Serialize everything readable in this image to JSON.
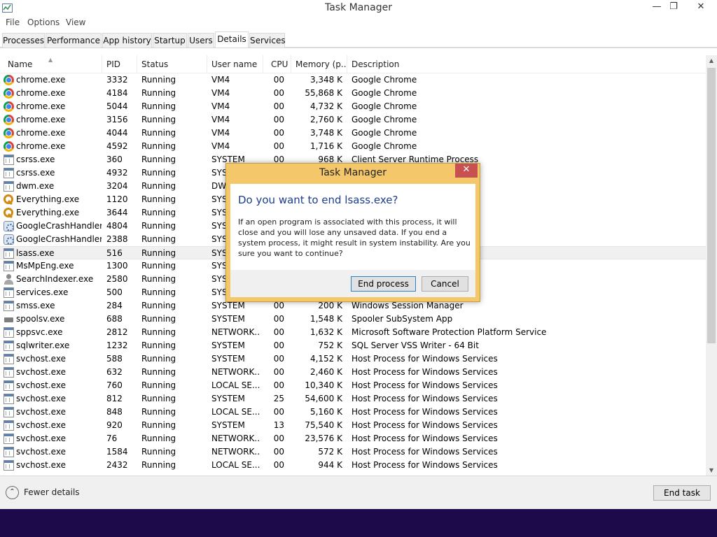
{
  "window": {
    "title": "Task Manager",
    "min_glyph": "—",
    "max_glyph": "❐",
    "close_glyph": "✕"
  },
  "menu": [
    "File",
    "Options",
    "View"
  ],
  "tabs": [
    "Processes",
    "Performance",
    "App history",
    "Startup",
    "Users",
    "Details",
    "Services"
  ],
  "active_tab": "Details",
  "columns": {
    "name": "Name",
    "pid": "PID",
    "status": "Status",
    "user": "User name",
    "cpu": "CPU",
    "memory": "Memory (p...",
    "description": "Description"
  },
  "rows": [
    {
      "icon": "chrome-icon",
      "name": "chrome.exe",
      "pid": "3332",
      "status": "Running",
      "user": "VM4",
      "cpu": "00",
      "memory": "3,348 K",
      "description": "Google Chrome"
    },
    {
      "icon": "chrome-icon",
      "name": "chrome.exe",
      "pid": "4184",
      "status": "Running",
      "user": "VM4",
      "cpu": "00",
      "memory": "55,868 K",
      "description": "Google Chrome"
    },
    {
      "icon": "chrome-icon",
      "name": "chrome.exe",
      "pid": "5044",
      "status": "Running",
      "user": "VM4",
      "cpu": "00",
      "memory": "4,732 K",
      "description": "Google Chrome"
    },
    {
      "icon": "chrome-icon",
      "name": "chrome.exe",
      "pid": "3156",
      "status": "Running",
      "user": "VM4",
      "cpu": "00",
      "memory": "2,760 K",
      "description": "Google Chrome"
    },
    {
      "icon": "chrome-icon",
      "name": "chrome.exe",
      "pid": "4044",
      "status": "Running",
      "user": "VM4",
      "cpu": "00",
      "memory": "3,748 K",
      "description": "Google Chrome"
    },
    {
      "icon": "chrome-icon",
      "name": "chrome.exe",
      "pid": "4592",
      "status": "Running",
      "user": "VM4",
      "cpu": "00",
      "memory": "1,716 K",
      "description": "Google Chrome"
    },
    {
      "icon": "exe-icon",
      "name": "csrss.exe",
      "pid": "360",
      "status": "Running",
      "user": "SYSTEM",
      "cpu": "00",
      "memory": "968 K",
      "description": "Client Server Runtime Process"
    },
    {
      "icon": "exe-icon",
      "name": "csrss.exe",
      "pid": "4932",
      "status": "Running",
      "user": "SYS",
      "cpu": "",
      "memory": "",
      "description": ""
    },
    {
      "icon": "exe-icon",
      "name": "dwm.exe",
      "pid": "3204",
      "status": "Running",
      "user": "DW",
      "cpu": "",
      "memory": "",
      "description": ""
    },
    {
      "icon": "key-icon",
      "name": "Everything.exe",
      "pid": "1120",
      "status": "Running",
      "user": "SYS",
      "cpu": "",
      "memory": "",
      "description": ""
    },
    {
      "icon": "key-icon",
      "name": "Everything.exe",
      "pid": "3644",
      "status": "Running",
      "user": "SYS",
      "cpu": "",
      "memory": "",
      "description": ""
    },
    {
      "icon": "gear-exe-icon",
      "name": "GoogleCrashHandler...",
      "pid": "4804",
      "status": "Running",
      "user": "SYS",
      "cpu": "",
      "memory": "",
      "description": ""
    },
    {
      "icon": "gear-exe-icon",
      "name": "GoogleCrashHandler...",
      "pid": "2388",
      "status": "Running",
      "user": "SYS",
      "cpu": "",
      "memory": "",
      "description": ""
    },
    {
      "icon": "exe-icon",
      "name": "lsass.exe",
      "pid": "516",
      "status": "Running",
      "user": "SYS",
      "cpu": "",
      "memory": "",
      "description": "",
      "selected": true
    },
    {
      "icon": "exe-icon",
      "name": "MsMpEng.exe",
      "pid": "1300",
      "status": "Running",
      "user": "SYS",
      "cpu": "",
      "memory": "",
      "description": ""
    },
    {
      "icon": "user-search-icon",
      "name": "SearchIndexer.exe",
      "pid": "2580",
      "status": "Running",
      "user": "SYS",
      "cpu": "",
      "memory": "",
      "description": ""
    },
    {
      "icon": "exe-icon",
      "name": "services.exe",
      "pid": "500",
      "status": "Running",
      "user": "SYS",
      "cpu": "",
      "memory": "",
      "description": ""
    },
    {
      "icon": "exe-icon",
      "name": "smss.exe",
      "pid": "284",
      "status": "Running",
      "user": "SYSTEM",
      "cpu": "00",
      "memory": "200 K",
      "description": "Windows Session Manager"
    },
    {
      "icon": "printer-icon",
      "name": "spoolsv.exe",
      "pid": "688",
      "status": "Running",
      "user": "SYSTEM",
      "cpu": "00",
      "memory": "1,548 K",
      "description": "Spooler SubSystem App"
    },
    {
      "icon": "exe-icon",
      "name": "sppsvc.exe",
      "pid": "2812",
      "status": "Running",
      "user": "NETWORK...",
      "cpu": "00",
      "memory": "1,632 K",
      "description": "Microsoft Software Protection Platform Service"
    },
    {
      "icon": "exe-icon",
      "name": "sqlwriter.exe",
      "pid": "1232",
      "status": "Running",
      "user": "SYSTEM",
      "cpu": "00",
      "memory": "752 K",
      "description": "SQL Server VSS Writer - 64 Bit"
    },
    {
      "icon": "exe-icon",
      "name": "svchost.exe",
      "pid": "588",
      "status": "Running",
      "user": "SYSTEM",
      "cpu": "00",
      "memory": "4,152 K",
      "description": "Host Process for Windows Services"
    },
    {
      "icon": "exe-icon",
      "name": "svchost.exe",
      "pid": "632",
      "status": "Running",
      "user": "NETWORK...",
      "cpu": "00",
      "memory": "2,460 K",
      "description": "Host Process for Windows Services"
    },
    {
      "icon": "exe-icon",
      "name": "svchost.exe",
      "pid": "760",
      "status": "Running",
      "user": "LOCAL SE...",
      "cpu": "00",
      "memory": "10,340 K",
      "description": "Host Process for Windows Services"
    },
    {
      "icon": "exe-icon",
      "name": "svchost.exe",
      "pid": "812",
      "status": "Running",
      "user": "SYSTEM",
      "cpu": "25",
      "memory": "54,600 K",
      "description": "Host Process for Windows Services"
    },
    {
      "icon": "exe-icon",
      "name": "svchost.exe",
      "pid": "848",
      "status": "Running",
      "user": "LOCAL SE...",
      "cpu": "00",
      "memory": "5,160 K",
      "description": "Host Process for Windows Services"
    },
    {
      "icon": "exe-icon",
      "name": "svchost.exe",
      "pid": "920",
      "status": "Running",
      "user": "SYSTEM",
      "cpu": "13",
      "memory": "75,540 K",
      "description": "Host Process for Windows Services"
    },
    {
      "icon": "exe-icon",
      "name": "svchost.exe",
      "pid": "76",
      "status": "Running",
      "user": "NETWORK...",
      "cpu": "00",
      "memory": "23,576 K",
      "description": "Host Process for Windows Services"
    },
    {
      "icon": "exe-icon",
      "name": "svchost.exe",
      "pid": "1584",
      "status": "Running",
      "user": "NETWORK...",
      "cpu": "00",
      "memory": "572 K",
      "description": "Host Process for Windows Services"
    },
    {
      "icon": "exe-icon",
      "name": "svchost.exe",
      "pid": "2432",
      "status": "Running",
      "user": "LOCAL SE...",
      "cpu": "00",
      "memory": "944 K",
      "description": "Host Process for Windows Services"
    }
  ],
  "footer": {
    "fewer_details": "Fewer details",
    "end_task": "End task"
  },
  "dialog": {
    "title": "Task Manager",
    "close_glyph": "✕",
    "question": "Do you want to end lsass.exe?",
    "message": "If an open program is associated with this process, it will close and you will lose any unsaved data. If you end a system process, it might result in system instability. Are you sure you want to continue?",
    "primary_button": "End process",
    "secondary_button": "Cancel"
  },
  "colors": {
    "dialog_border": "#f4c86a",
    "dialog_close": "#c75050",
    "question_text": "#1b3d8f",
    "taskbar": "#1d0a4a"
  }
}
